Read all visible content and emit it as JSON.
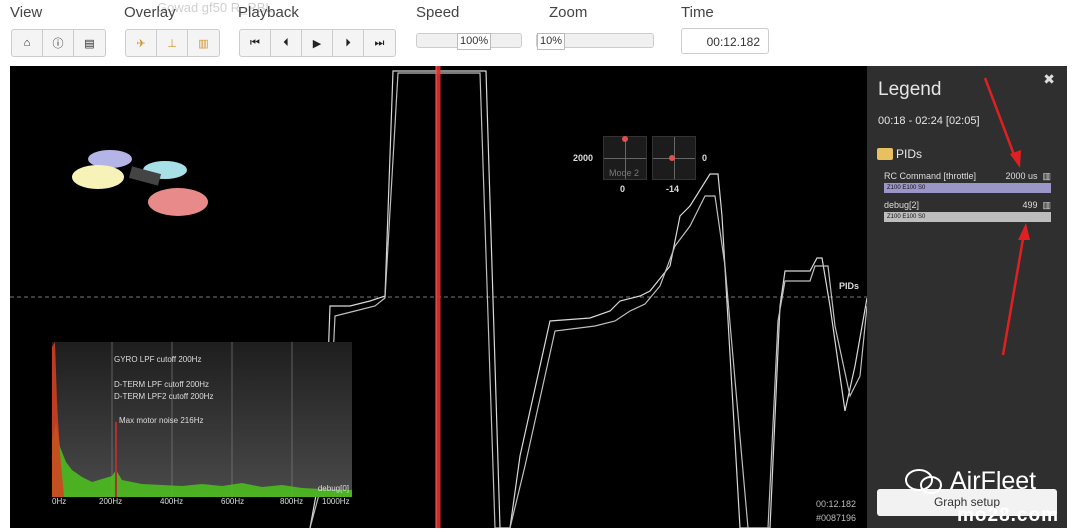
{
  "toolbar": {
    "view_label": "View",
    "overlay_label": "Overlay",
    "overlay_ghost_text": "Gowad gf50 R_RBL",
    "playback_label": "Playback",
    "speed_label": "Speed",
    "zoom_label": "Zoom",
    "time_label": "Time",
    "speed_value": "100%",
    "speed_level": 0.43,
    "zoom_value": "10%",
    "zoom_level": 0.03,
    "time_value": "00:12.182",
    "view_buttons": [
      "home-icon",
      "info-icon",
      "table-icon"
    ],
    "overlay_buttons": [
      "craft-icon",
      "sticks-icon",
      "spectrum-icon"
    ],
    "playback_buttons": [
      "first-icon",
      "prev-icon",
      "play-icon",
      "next-icon",
      "last-icon"
    ]
  },
  "graph": {
    "stick_left_value": "2000",
    "stick_left_bottom": "0",
    "stick_mode": "Mode 2",
    "stick_right_value": "0",
    "stick_right_bottom": "-14",
    "pids_label": "PIDs",
    "time_readout": "00:12.182",
    "frame_readout": "#0087196",
    "cursor_color": "#e03030"
  },
  "spectrum": {
    "notes": [
      "GYRO LPF cutoff 200Hz",
      "D-TERM LPF cutoff 200Hz",
      "D-TERM LPF2 cutoff 200Hz",
      "Max motor noise 216Hz"
    ],
    "ticks": [
      "0Hz",
      "200Hz",
      "400Hz",
      "600Hz",
      "800Hz",
      "1000Hz"
    ],
    "series_label": "debug[0]"
  },
  "legend": {
    "title": "Legend",
    "close": "✖",
    "range": "00:18 - 02:24 [02:05]",
    "group": "PIDs",
    "series": [
      {
        "name": "RC Command [throttle]",
        "value": "2000 us",
        "bar": "Z100 E100 S0",
        "color": "#9a96c8"
      },
      {
        "name": "debug[2]",
        "value": "499",
        "bar": "Z100 E100 S0",
        "color": "#bdbdbd"
      }
    ],
    "setup_button": "Graph setup"
  },
  "watermark": {
    "brand": "AirFleet",
    "site": "mo28.com"
  },
  "colors": {
    "annotation_arrow": "#e02020",
    "graph_bg": "#000000",
    "legend_bg": "#2f2f2f"
  }
}
